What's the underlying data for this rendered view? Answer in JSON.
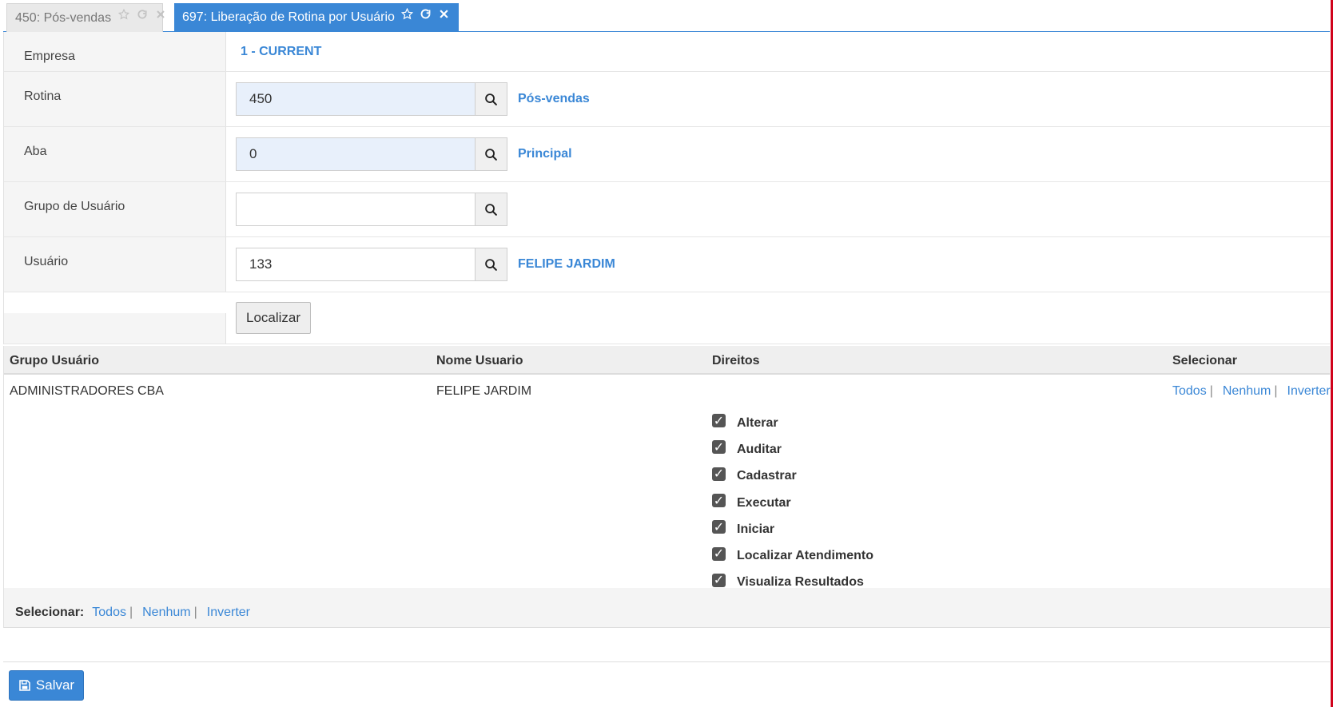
{
  "colors": {
    "accent": "#3a87d6",
    "edge": "#d0021b"
  },
  "tabs": [
    {
      "label": "450: Pós-vendas",
      "active": false
    },
    {
      "label": "697: Liberação de Rotina por Usuário",
      "active": true
    }
  ],
  "tab_icons": [
    "star-icon",
    "refresh-icon",
    "close-icon"
  ],
  "form": {
    "empresa": {
      "label": "Empresa",
      "value": "1 - CURRENT"
    },
    "rotina": {
      "label": "Rotina",
      "value": "450",
      "desc": "Pós-vendas"
    },
    "aba": {
      "label": "Aba",
      "value": "0",
      "desc": "Principal"
    },
    "grupo": {
      "label": "Grupo de Usuário",
      "value": "",
      "desc": ""
    },
    "usuario": {
      "label": "Usuário",
      "value": "133",
      "desc": "FELIPE JARDIM"
    },
    "localizar_label": "Localizar"
  },
  "table": {
    "headers": {
      "grupo": "Grupo Usuário",
      "nome": "Nome Usuario",
      "direitos": "Direitos",
      "selecionar": "Selecionar"
    },
    "row": {
      "grupo": "ADMINISTRADORES CBA",
      "nome": "FELIPE JARDIM",
      "rights": [
        {
          "label": "Alterar",
          "checked": true
        },
        {
          "label": "Auditar",
          "checked": true
        },
        {
          "label": "Cadastrar",
          "checked": true
        },
        {
          "label": "Executar",
          "checked": true
        },
        {
          "label": "Iniciar",
          "checked": true
        },
        {
          "label": "Localizar Atendimento",
          "checked": true
        },
        {
          "label": "Visualiza Resultados",
          "checked": true
        }
      ],
      "select_links": {
        "all": "Todos",
        "none": "Nenhum",
        "invert": "Inverter"
      }
    }
  },
  "footer": {
    "select_label": "Selecionar:",
    "links": {
      "all": "Todos",
      "none": "Nenhum",
      "invert": "Inverter"
    }
  },
  "save_label": "Salvar"
}
